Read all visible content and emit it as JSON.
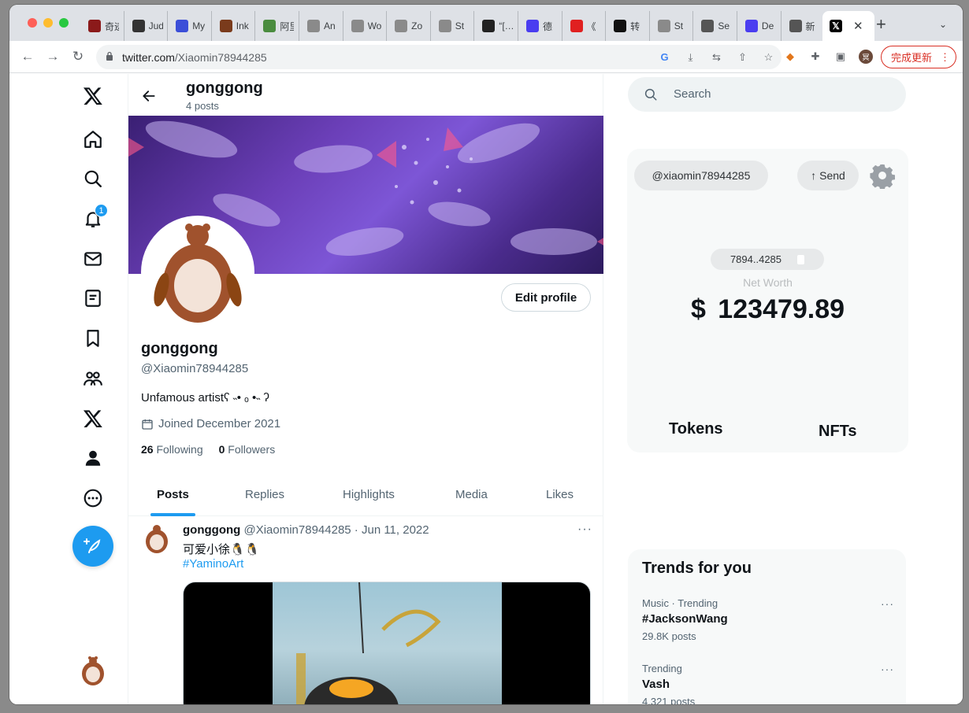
{
  "browser": {
    "tabs": [
      {
        "title": "奇迹",
        "icon_color": "#8b1a1a",
        "icon": "red-figure-icon"
      },
      {
        "title": "Judge",
        "icon_color": "#333333",
        "icon": "grid-icon"
      },
      {
        "title": "My",
        "icon_color": "#3b4ed8",
        "icon": "chevron-logo-icon"
      },
      {
        "title": "Ink",
        "icon_color": "#7a3b1c",
        "icon": "ink-logo-icon"
      },
      {
        "title": "阿里",
        "icon_color": "#4a8c3f",
        "icon": "map-icon"
      },
      {
        "title": "An",
        "icon_color": "#8a8a8a",
        "icon": "openai-icon"
      },
      {
        "title": "Wo",
        "icon_color": "#8a8a8a",
        "icon": "openai-icon"
      },
      {
        "title": "Zo",
        "icon_color": "#8a8a8a",
        "icon": "openai-icon"
      },
      {
        "title": "St",
        "icon_color": "#8a8a8a",
        "icon": "openai-icon"
      },
      {
        "title": "“[…",
        "icon_color": "#222222",
        "icon": "columns-icon"
      },
      {
        "title": "德",
        "icon_color": "#4a3df0",
        "icon": "de-logo-icon"
      },
      {
        "title": "《",
        "icon_color": "#e02020",
        "icon": "red-logo-icon"
      },
      {
        "title": "转",
        "icon_color": "#111111",
        "icon": "notion-icon"
      },
      {
        "title": "St",
        "icon_color": "#8a8a8a",
        "icon": "openai-icon"
      },
      {
        "title": "Se",
        "icon_color": "#555555",
        "icon": "globe-icon"
      },
      {
        "title": "De",
        "icon_color": "#4a3df0",
        "icon": "de-logo-icon"
      },
      {
        "title": "新",
        "icon_color": "#555555",
        "icon": "chrome-icon"
      }
    ],
    "active_tab_icon": "x-logo-icon",
    "url_domain": "twitter.com",
    "url_path": "/Xiaomin78944285",
    "update_label": "完成更新",
    "profile_initial": "冥"
  },
  "nav": {
    "notification_count": "1",
    "items": [
      "x-logo",
      "home",
      "explore",
      "notifications",
      "messages",
      "lists",
      "bookmarks",
      "communities",
      "premium",
      "profile",
      "more"
    ]
  },
  "profile": {
    "header_name": "gonggong",
    "header_posts": "4 posts",
    "name": "gonggong",
    "handle": "@Xiaomin78944285",
    "bio": "Unfamous artistʕ ˵• ₒ •˵ ʔ",
    "joined": "Joined December 2021",
    "following_count": "26",
    "following_label": "Following",
    "followers_count": "0",
    "followers_label": "Followers",
    "edit_label": "Edit profile",
    "tabs": [
      "Posts",
      "Replies",
      "Highlights",
      "Media",
      "Likes"
    ]
  },
  "tweet": {
    "name": "gonggong",
    "meta": "@Xiaomin78944285 · Jun 11, 2022",
    "text": "可爱小徐🐧🐧",
    "hashtag": "#YaminoArt"
  },
  "search": {
    "placeholder": "Search"
  },
  "wallet": {
    "handle": "@xiaomin78944285",
    "send_label": "Send",
    "address": "7894..4285",
    "net_worth_label": "Net Worth",
    "net_worth": "$ 123479.89",
    "tokens_label": "Tokens",
    "nfts_label": "NFTs"
  },
  "trends": {
    "title": "Trends for you",
    "items": [
      {
        "category": "Music · Trending",
        "name": "#JacksonWang",
        "count": "29.8K posts"
      },
      {
        "category": "Trending",
        "name": "Vash",
        "count": "4,321 posts"
      }
    ]
  },
  "colors": {
    "accent": "#1d9bf0",
    "text": "#0f1419",
    "muted": "#536471"
  }
}
